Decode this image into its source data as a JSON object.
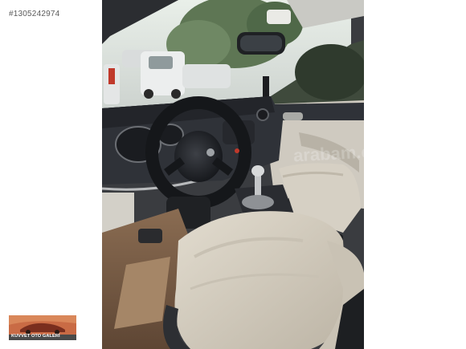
{
  "listing": {
    "id_text": "#1305242974"
  },
  "photo": {
    "subject": "Car interior: steering wheel, dashboard, gear shifter and light beige front seat",
    "watermark_text": "arabam.com"
  },
  "seller": {
    "logo_text": "KUVVET OTO GALERİ"
  },
  "colors": {
    "background": "#ffffff",
    "seat": "#d4cdbf",
    "dashboard": "#2f3238",
    "sky_glare": "#f2f4f2",
    "logo_orange": "#c96b45"
  }
}
